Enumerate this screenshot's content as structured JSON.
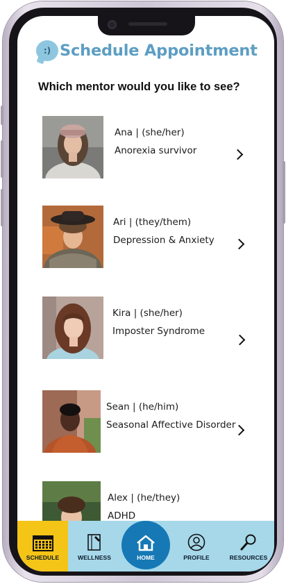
{
  "header": {
    "icon": "chat-bubble-icon",
    "icon_text": ":)",
    "title": "Schedule Appointment"
  },
  "question": "Which mentor would you like to see?",
  "mentors": [
    {
      "name": "Ana | (she/her)",
      "topic": "Anorexia survivor"
    },
    {
      "name": "Ari | (they/them)",
      "topic": "Depression & Anxiety"
    },
    {
      "name": "Kira | (she/her)",
      "topic": "Imposter Syndrome"
    },
    {
      "name": "Sean | (he/him)",
      "topic": "Seasonal Affective Disorder"
    },
    {
      "name": "Alex | (he/they)",
      "topic": "ADHD"
    }
  ],
  "nav": {
    "items": [
      {
        "label": "SCHEDULE",
        "icon": "calendar-icon",
        "active": true
      },
      {
        "label": "WELLNESS",
        "icon": "notebook-icon",
        "active": false
      },
      {
        "label": "HOME",
        "icon": "home-icon",
        "active": false
      },
      {
        "label": "PROFILE",
        "icon": "user-circle-icon",
        "active": false
      },
      {
        "label": "RESOURCES",
        "icon": "magnifier-icon",
        "active": false
      }
    ],
    "colors": {
      "bar": "#a6d8ea",
      "active": "#f4c417",
      "home": "#1679b5"
    }
  },
  "colors": {
    "title": "#5d9ec3",
    "icon": "#8ec6e0"
  }
}
